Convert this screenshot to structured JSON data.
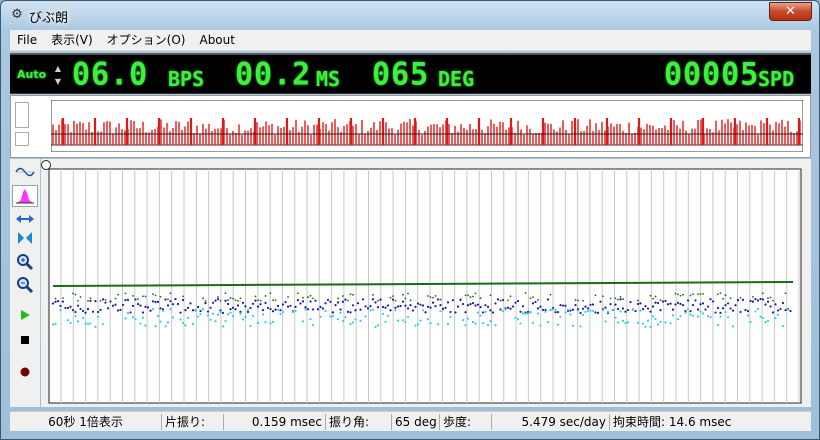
{
  "window": {
    "title": "びぶ朗",
    "close_label": "✕"
  },
  "menu": [
    {
      "label": "File"
    },
    {
      "label": "表示(V)"
    },
    {
      "label": "オプション(O)"
    },
    {
      "label": "About"
    }
  ],
  "led": {
    "auto_label": "Auto",
    "bps_value": "06.0",
    "bps_unit": "BPS",
    "ms_value": "00.2",
    "ms_unit": "MS",
    "deg_value": "065",
    "deg_unit": "DEG",
    "spd_value": "00005",
    "spd_unit": "SPD",
    "color": "#3cf03c"
  },
  "toolbar": [
    {
      "name": "waveform-tool",
      "icon": "sine-wave-icon"
    },
    {
      "name": "histogram-tool",
      "icon": "histogram-icon",
      "active": true
    },
    {
      "name": "expand-horizontal-tool",
      "icon": "expand-horizontal-icon"
    },
    {
      "name": "shrink-tool",
      "icon": "shrink-icon"
    },
    {
      "name": "zoom-in-tool",
      "icon": "zoom-in-icon"
    },
    {
      "name": "zoom-out-tool",
      "icon": "zoom-out-icon"
    },
    {
      "name": "play-button",
      "icon": "play-icon"
    },
    {
      "name": "stop-button",
      "icon": "stop-icon"
    },
    {
      "name": "record-button",
      "icon": "record-icon"
    }
  ],
  "colors": {
    "overview_bars": "#e01818",
    "trace_green": "#1a6a1a",
    "trace_blue": "#1a1aa0",
    "trace_cyan": "#30d0e0"
  },
  "status": {
    "display_mode": "60秒 1倍表示",
    "amplitude_label": "片振り:",
    "amplitude_value": "0.159 msec",
    "swing_label": "振り角:",
    "swing_value": "65 deg",
    "rate_label": "歩度:",
    "rate_value": "5.479 sec/day",
    "lock_label": "拘束時間: 14.6 msec"
  }
}
